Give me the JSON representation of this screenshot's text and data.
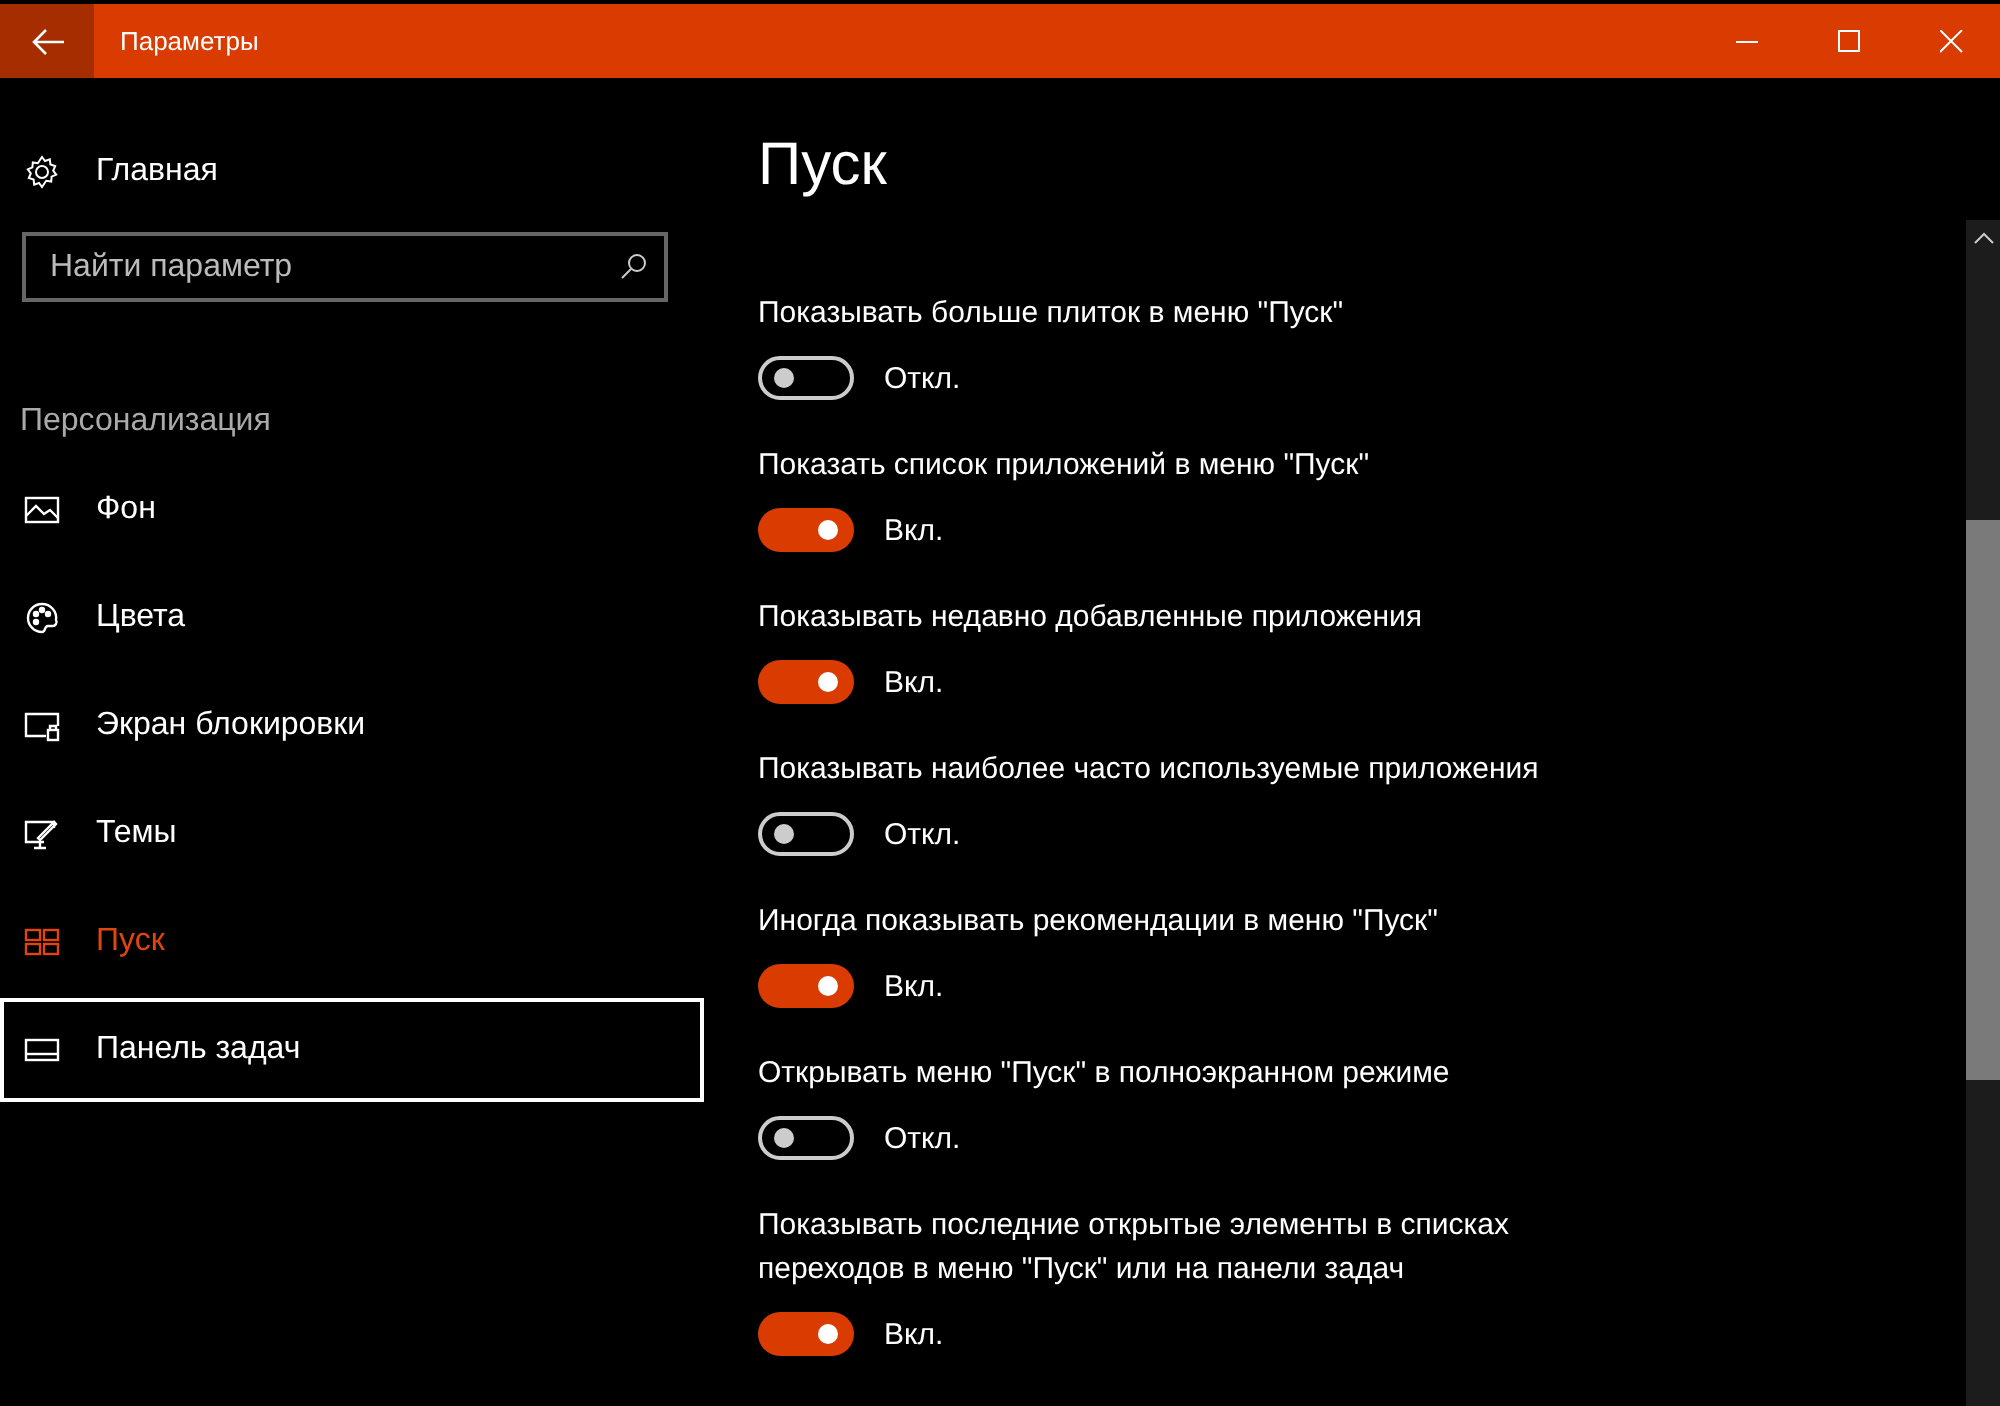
{
  "window": {
    "title": "Параметры"
  },
  "sidebar": {
    "home": "Главная",
    "search": {
      "placeholder": "Найти параметр"
    },
    "section": "Персонализация",
    "items": [
      {
        "label": "Фон",
        "kind": "picture",
        "selected": false,
        "focused": false
      },
      {
        "label": "Цвета",
        "kind": "palette",
        "selected": false,
        "focused": false
      },
      {
        "label": "Экран блокировки",
        "kind": "lockscreen",
        "selected": false,
        "focused": false
      },
      {
        "label": "Темы",
        "kind": "themes",
        "selected": false,
        "focused": false
      },
      {
        "label": "Пуск",
        "kind": "start",
        "selected": true,
        "focused": false
      },
      {
        "label": "Панель задач",
        "kind": "taskbar",
        "selected": false,
        "focused": true
      }
    ]
  },
  "page": {
    "title": "Пуск",
    "settings": [
      {
        "label": "Показывать больше плиток в меню \"Пуск\"",
        "on": false,
        "state": "Откл."
      },
      {
        "label": "Показать список приложений в меню \"Пуск\"",
        "on": true,
        "state": "Вкл."
      },
      {
        "label": "Показывать недавно добавленные приложения",
        "on": true,
        "state": "Вкл."
      },
      {
        "label": "Показывать наиболее часто используемые приложения",
        "on": false,
        "state": "Откл."
      },
      {
        "label": "Иногда показывать рекомендации в меню \"Пуск\"",
        "on": true,
        "state": "Вкл."
      },
      {
        "label": "Открывать меню \"Пуск\" в полноэкранном режиме",
        "on": false,
        "state": "Откл."
      },
      {
        "label": "Показывать последние открытые элементы в списках переходов в меню \"Пуск\" или на панели задач",
        "on": true,
        "state": "Вкл."
      }
    ]
  }
}
